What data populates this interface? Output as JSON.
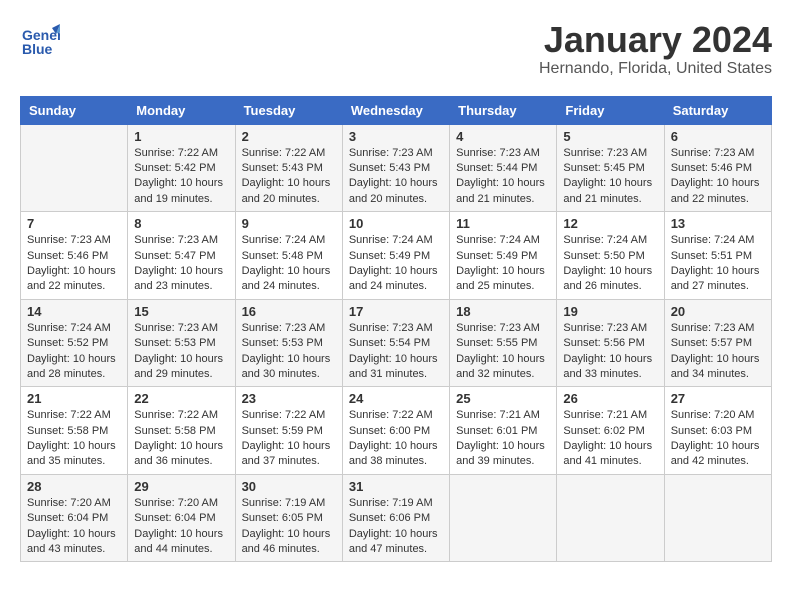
{
  "header": {
    "title": "January 2024",
    "location": "Hernando, Florida, United States",
    "logo_line1": "General",
    "logo_line2": "Blue"
  },
  "days_of_week": [
    "Sunday",
    "Monday",
    "Tuesday",
    "Wednesday",
    "Thursday",
    "Friday",
    "Saturday"
  ],
  "weeks": [
    [
      {
        "day": "",
        "info": ""
      },
      {
        "day": "1",
        "info": "Sunrise: 7:22 AM\nSunset: 5:42 PM\nDaylight: 10 hours\nand 19 minutes."
      },
      {
        "day": "2",
        "info": "Sunrise: 7:22 AM\nSunset: 5:43 PM\nDaylight: 10 hours\nand 20 minutes."
      },
      {
        "day": "3",
        "info": "Sunrise: 7:23 AM\nSunset: 5:43 PM\nDaylight: 10 hours\nand 20 minutes."
      },
      {
        "day": "4",
        "info": "Sunrise: 7:23 AM\nSunset: 5:44 PM\nDaylight: 10 hours\nand 21 minutes."
      },
      {
        "day": "5",
        "info": "Sunrise: 7:23 AM\nSunset: 5:45 PM\nDaylight: 10 hours\nand 21 minutes."
      },
      {
        "day": "6",
        "info": "Sunrise: 7:23 AM\nSunset: 5:46 PM\nDaylight: 10 hours\nand 22 minutes."
      }
    ],
    [
      {
        "day": "7",
        "info": "Sunrise: 7:23 AM\nSunset: 5:46 PM\nDaylight: 10 hours\nand 22 minutes."
      },
      {
        "day": "8",
        "info": "Sunrise: 7:23 AM\nSunset: 5:47 PM\nDaylight: 10 hours\nand 23 minutes."
      },
      {
        "day": "9",
        "info": "Sunrise: 7:24 AM\nSunset: 5:48 PM\nDaylight: 10 hours\nand 24 minutes."
      },
      {
        "day": "10",
        "info": "Sunrise: 7:24 AM\nSunset: 5:49 PM\nDaylight: 10 hours\nand 24 minutes."
      },
      {
        "day": "11",
        "info": "Sunrise: 7:24 AM\nSunset: 5:49 PM\nDaylight: 10 hours\nand 25 minutes."
      },
      {
        "day": "12",
        "info": "Sunrise: 7:24 AM\nSunset: 5:50 PM\nDaylight: 10 hours\nand 26 minutes."
      },
      {
        "day": "13",
        "info": "Sunrise: 7:24 AM\nSunset: 5:51 PM\nDaylight: 10 hours\nand 27 minutes."
      }
    ],
    [
      {
        "day": "14",
        "info": "Sunrise: 7:24 AM\nSunset: 5:52 PM\nDaylight: 10 hours\nand 28 minutes."
      },
      {
        "day": "15",
        "info": "Sunrise: 7:23 AM\nSunset: 5:53 PM\nDaylight: 10 hours\nand 29 minutes."
      },
      {
        "day": "16",
        "info": "Sunrise: 7:23 AM\nSunset: 5:53 PM\nDaylight: 10 hours\nand 30 minutes."
      },
      {
        "day": "17",
        "info": "Sunrise: 7:23 AM\nSunset: 5:54 PM\nDaylight: 10 hours\nand 31 minutes."
      },
      {
        "day": "18",
        "info": "Sunrise: 7:23 AM\nSunset: 5:55 PM\nDaylight: 10 hours\nand 32 minutes."
      },
      {
        "day": "19",
        "info": "Sunrise: 7:23 AM\nSunset: 5:56 PM\nDaylight: 10 hours\nand 33 minutes."
      },
      {
        "day": "20",
        "info": "Sunrise: 7:23 AM\nSunset: 5:57 PM\nDaylight: 10 hours\nand 34 minutes."
      }
    ],
    [
      {
        "day": "21",
        "info": "Sunrise: 7:22 AM\nSunset: 5:58 PM\nDaylight: 10 hours\nand 35 minutes."
      },
      {
        "day": "22",
        "info": "Sunrise: 7:22 AM\nSunset: 5:58 PM\nDaylight: 10 hours\nand 36 minutes."
      },
      {
        "day": "23",
        "info": "Sunrise: 7:22 AM\nSunset: 5:59 PM\nDaylight: 10 hours\nand 37 minutes."
      },
      {
        "day": "24",
        "info": "Sunrise: 7:22 AM\nSunset: 6:00 PM\nDaylight: 10 hours\nand 38 minutes."
      },
      {
        "day": "25",
        "info": "Sunrise: 7:21 AM\nSunset: 6:01 PM\nDaylight: 10 hours\nand 39 minutes."
      },
      {
        "day": "26",
        "info": "Sunrise: 7:21 AM\nSunset: 6:02 PM\nDaylight: 10 hours\nand 41 minutes."
      },
      {
        "day": "27",
        "info": "Sunrise: 7:20 AM\nSunset: 6:03 PM\nDaylight: 10 hours\nand 42 minutes."
      }
    ],
    [
      {
        "day": "28",
        "info": "Sunrise: 7:20 AM\nSunset: 6:04 PM\nDaylight: 10 hours\nand 43 minutes."
      },
      {
        "day": "29",
        "info": "Sunrise: 7:20 AM\nSunset: 6:04 PM\nDaylight: 10 hours\nand 44 minutes."
      },
      {
        "day": "30",
        "info": "Sunrise: 7:19 AM\nSunset: 6:05 PM\nDaylight: 10 hours\nand 46 minutes."
      },
      {
        "day": "31",
        "info": "Sunrise: 7:19 AM\nSunset: 6:06 PM\nDaylight: 10 hours\nand 47 minutes."
      },
      {
        "day": "",
        "info": ""
      },
      {
        "day": "",
        "info": ""
      },
      {
        "day": "",
        "info": ""
      }
    ]
  ]
}
